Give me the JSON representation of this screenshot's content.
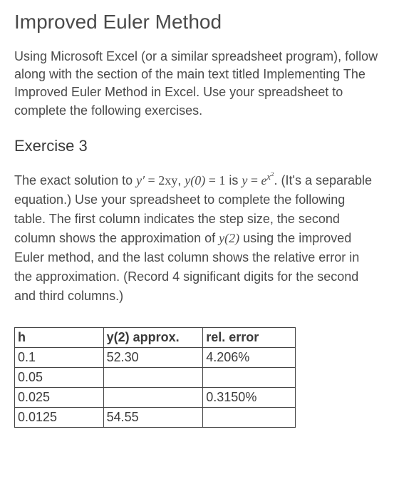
{
  "title": "Improved Euler Method",
  "intro": "Using Microsoft Excel (or a similar spreadsheet program), follow along with the section of the main text titled Implementing The Improved Euler Method in Excel. Use your spreadsheet to complete the following exercises.",
  "exercise": {
    "heading": "Exercise 3",
    "text_parts": {
      "p1": "The exact solution to ",
      "eq1_lhs": "y′",
      "eq1_eq": " = ",
      "eq1_rhs": "2xy",
      "comma": ",  ",
      "ic_lhs": "y(0)",
      "ic_eq": " = ",
      "ic_rhs": "1",
      "p2": " is ",
      "sol_lhs": "y",
      "sol_eq": " = ",
      "sol_rhs_base": "e",
      "sol_rhs_exp_var": "x",
      "sol_rhs_exp_pow": "2",
      "p3": ". (It's a separable equation.) Use your spreadsheet to complete the following table. The first column indicates the step size, the second column shows the approximation of ",
      "y2": "y(2)",
      "p4": " using the improved Euler method, and the last column shows the relative error in the approximation. (Record 4 significant digits for the second and third columns.)"
    }
  },
  "chart_data": {
    "type": "table",
    "headers": [
      "h",
      "y(2) approx.",
      "rel. error"
    ],
    "rows": [
      [
        "0.1",
        "52.30",
        "4.206%"
      ],
      [
        "0.05",
        "",
        ""
      ],
      [
        "0.025",
        "",
        "0.3150%"
      ],
      [
        "0.0125",
        "54.55",
        ""
      ]
    ]
  }
}
